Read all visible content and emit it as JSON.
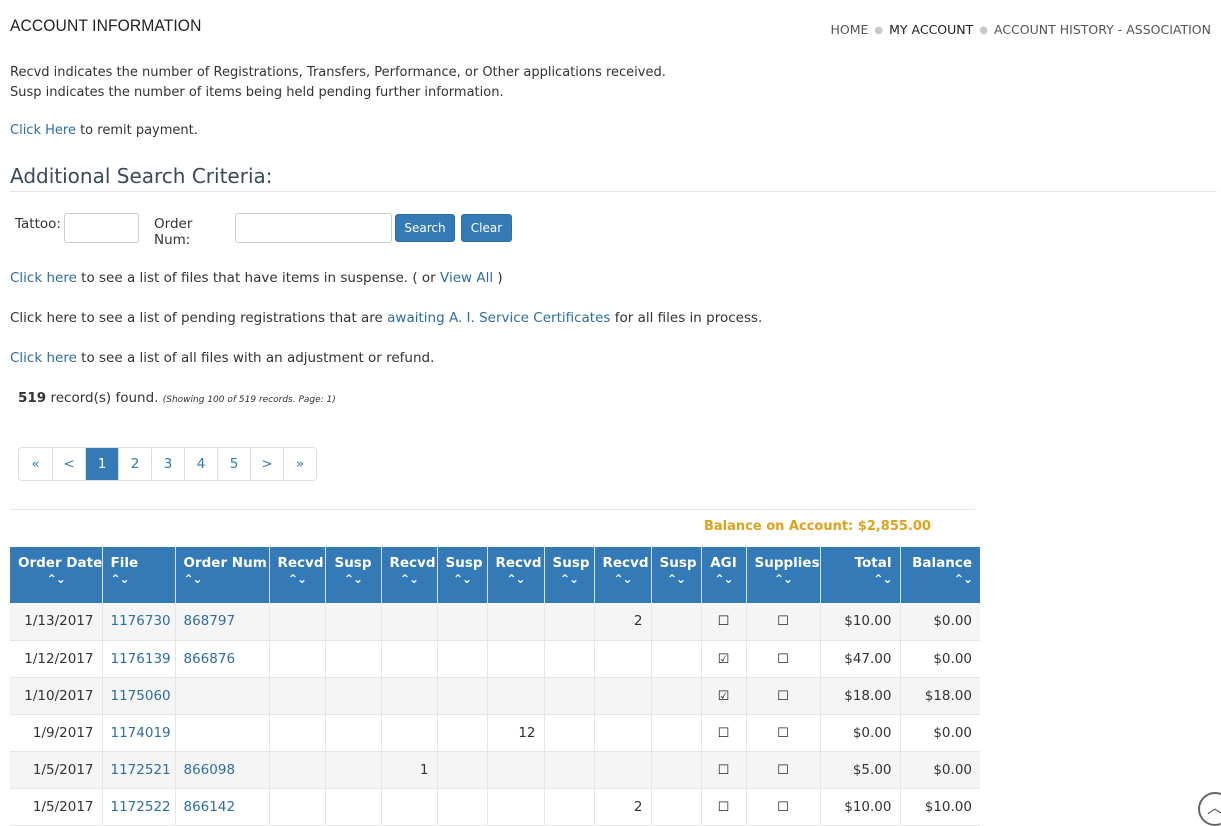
{
  "header": {
    "title": "ACCOUNT INFORMATION",
    "breadcrumb": [
      "HOME",
      "MY ACCOUNT",
      "ACCOUNT HISTORY - ASSOCIATION"
    ]
  },
  "intro": {
    "line1": "Recvd indicates the number of Registrations, Transfers, Performance, or Other applications received.",
    "line2": "Susp indicates the number of items being held pending further information."
  },
  "remit": {
    "link": "Click Here",
    "text": " to remit payment."
  },
  "search": {
    "section_title": "Additional Search Criteria:",
    "tattoo_label": "Tattoo:",
    "order_label": "Order Num:",
    "tattoo_value": "",
    "order_value": "",
    "search_button": "Search",
    "clear_button": "Clear"
  },
  "links": {
    "suspense_link": "Click here",
    "suspense_text": " to see a list of files that have items in suspense. ( or ",
    "view_all": "View All",
    "suspense_close": " )",
    "pending_text1": "Click here to see a list of pending registrations that are ",
    "pending_link": "awaiting A. I. Service Certificates",
    "pending_text2": " for all files in process.",
    "adjust_link": "Click here",
    "adjust_text": " to see a list of all files with an adjustment or refund."
  },
  "records": {
    "count": "519",
    "found_text": " record(s) found. ",
    "showing": "(Showing 100 of 519 records. Page: 1)"
  },
  "pagination": [
    "«",
    "<",
    "1",
    "2",
    "3",
    "4",
    "5",
    ">",
    "»"
  ],
  "pagination_active": "1",
  "balance": "Balance on Account: $2,855.00",
  "table": {
    "headers": [
      "Order Date",
      "File",
      "Order Num",
      "Recvd",
      "Susp",
      "Recvd",
      "Susp",
      "Recvd",
      "Susp",
      "Recvd",
      "Susp",
      "AGI",
      "Supplies",
      "Total",
      "Balance"
    ],
    "sort_glyph": "⌃⌄",
    "rows": [
      {
        "date": "1/13/2017",
        "file": "1176730",
        "order": "868797",
        "r1": "",
        "s1": "",
        "r2": "",
        "s2": "",
        "r3": "",
        "s3": "",
        "r4": "2",
        "s4": "",
        "agi": "☐",
        "supplies": "☐",
        "total": "$10.00",
        "balance": "$0.00"
      },
      {
        "date": "1/12/2017",
        "file": "1176139",
        "order": "866876",
        "r1": "",
        "s1": "",
        "r2": "",
        "s2": "",
        "r3": "",
        "s3": "",
        "r4": "",
        "s4": "",
        "agi": "☑",
        "supplies": "☐",
        "total": "$47.00",
        "balance": "$0.00"
      },
      {
        "date": "1/10/2017",
        "file": "1175060",
        "order": "",
        "r1": "",
        "s1": "",
        "r2": "",
        "s2": "",
        "r3": "",
        "s3": "",
        "r4": "",
        "s4": "",
        "agi": "☑",
        "supplies": "☐",
        "total": "$18.00",
        "balance": "$18.00"
      },
      {
        "date": "1/9/2017",
        "file": "1174019",
        "order": "",
        "r1": "",
        "s1": "",
        "r2": "",
        "s2": "",
        "r3": "12",
        "s3": "",
        "r4": "",
        "s4": "",
        "agi": "☐",
        "supplies": "☐",
        "total": "$0.00",
        "balance": "$0.00"
      },
      {
        "date": "1/5/2017",
        "file": "1172521",
        "order": "866098",
        "r1": "",
        "s1": "",
        "r2": "1",
        "s2": "",
        "r3": "",
        "s3": "",
        "r4": "",
        "s4": "",
        "agi": "☐",
        "supplies": "☐",
        "total": "$5.00",
        "balance": "$0.00"
      },
      {
        "date": "1/5/2017",
        "file": "1172522",
        "order": "866142",
        "r1": "",
        "s1": "",
        "r2": "",
        "s2": "",
        "r3": "",
        "s3": "",
        "r4": "2",
        "s4": "",
        "agi": "☐",
        "supplies": "☐",
        "total": "$10.00",
        "balance": "$10.00"
      }
    ]
  },
  "colors": {
    "accent": "#337ab7",
    "balance": "#e0a21a",
    "link": "#2e6da4"
  },
  "icons": {
    "scroll_top": "chevron-up-icon"
  }
}
